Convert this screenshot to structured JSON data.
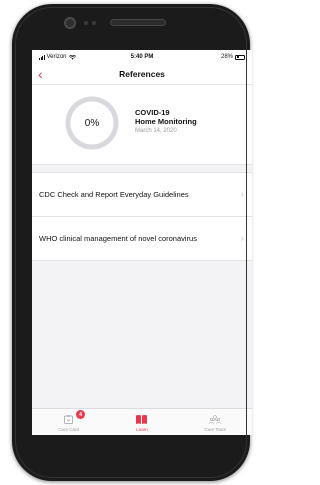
{
  "status_bar": {
    "carrier": "Verizon",
    "time": "5:40 PM",
    "battery": "28%"
  },
  "nav": {
    "title": "References",
    "back_icon": "chevron-left-icon"
  },
  "header": {
    "progress_label": "0%",
    "progress": 0,
    "title": "COVID-19",
    "subtitle": "Home Monitoring",
    "date": "March 14, 2020"
  },
  "references": [
    {
      "label": "CDC Check and Report Everyday Guidelines"
    },
    {
      "label": "WHO clinical management of novel coronavirus"
    }
  ],
  "tabs": [
    {
      "label": "Care Card",
      "icon": "care-card-icon",
      "badge": "4"
    },
    {
      "label": "Learn",
      "icon": "book-icon"
    },
    {
      "label": "Care Team",
      "icon": "people-icon"
    }
  ],
  "colors": {
    "accent": "#e8384f",
    "ring": "#d9d9dd",
    "background": "#f3f3f6"
  }
}
